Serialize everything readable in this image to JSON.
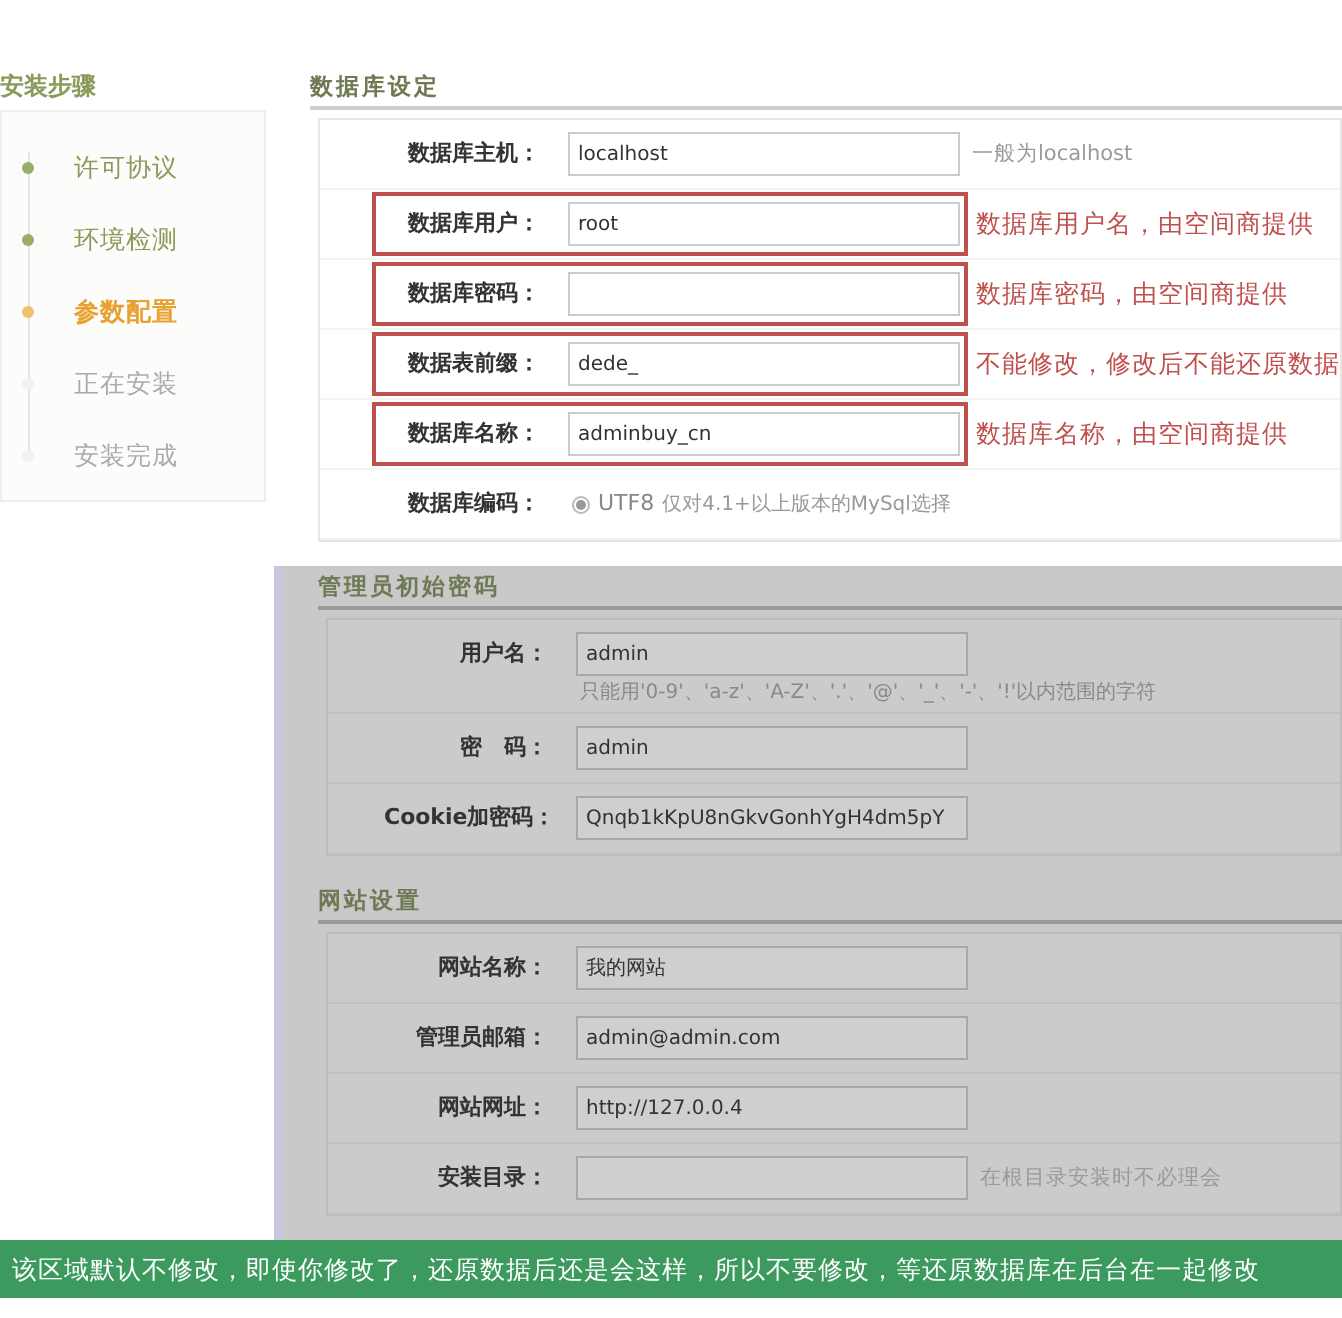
{
  "sidebar": {
    "title": "安装步骤",
    "steps": [
      {
        "label": "许可协议",
        "done": true,
        "current": false
      },
      {
        "label": "环境检测",
        "done": true,
        "current": false
      },
      {
        "label": "参数配置",
        "done": false,
        "current": true
      },
      {
        "label": "正在安装",
        "done": false,
        "current": false
      },
      {
        "label": "安装完成",
        "done": false,
        "current": false
      }
    ]
  },
  "sections": [
    {
      "title": "数据库设定",
      "dimmed": false,
      "rows": [
        {
          "kind": "input",
          "label": "数据库主机：",
          "value": "localhost",
          "hint": "一般为localhost",
          "highlighted": false
        },
        {
          "kind": "input",
          "label": "数据库用户：",
          "value": "root",
          "hint": "数据库用户名，由空间商提供",
          "highlighted": true
        },
        {
          "kind": "input",
          "label": "数据库密码：",
          "hint": "数据库密码，由空间商提供",
          "highlighted": true
        },
        {
          "kind": "input",
          "label": "数据表前缀：",
          "value": "dede_",
          "hint": "不能修改，修改后不能还原数据",
          "highlighted": true
        },
        {
          "kind": "input",
          "label": "数据库名称：",
          "value": "adminbuy_cn",
          "hint": "数据库名称，由空间商提供",
          "highlighted": true
        },
        {
          "kind": "radio",
          "label": "数据库编码：",
          "option": "UTF8",
          "note": "仅对4.1+以上版本的MySql选择",
          "selected": true
        }
      ]
    },
    {
      "title": "管理员初始密码",
      "dimmed": true,
      "rows": [
        {
          "kind": "input",
          "label": "用户名：",
          "value": "admin",
          "below": "只能用'0-9'、'a-z'、'A-Z'、'.'、'@'、'_'、'-'、'!'以内范围的字符",
          "highlighted": false
        },
        {
          "kind": "input",
          "label": "密　码：",
          "value": "admin",
          "highlighted": false
        },
        {
          "kind": "input",
          "label": "Cookie加密码：",
          "value": "Qnqb1kKpU8nGkvGonhYgH4dm5pY",
          "highlighted": false
        }
      ]
    },
    {
      "title": "网站设置",
      "dimmed": true,
      "rows": [
        {
          "kind": "input",
          "label": "网站名称：",
          "value": "我的网站",
          "highlighted": false
        },
        {
          "kind": "input",
          "label": "管理员邮箱：",
          "value": "admin@admin.com",
          "highlighted": false
        },
        {
          "kind": "input",
          "label": "网站网址：",
          "value": "http://127.0.0.4",
          "highlighted": false
        },
        {
          "kind": "input",
          "label": "安装目录：",
          "hint": "在根目录安装时不必理会",
          "highlighted": false
        }
      ]
    }
  ],
  "banner": "该区域默认不修改，即使你修改了，还原数据后还是会这样，所以不要修改，等还原数据库在后台在一起修改"
}
